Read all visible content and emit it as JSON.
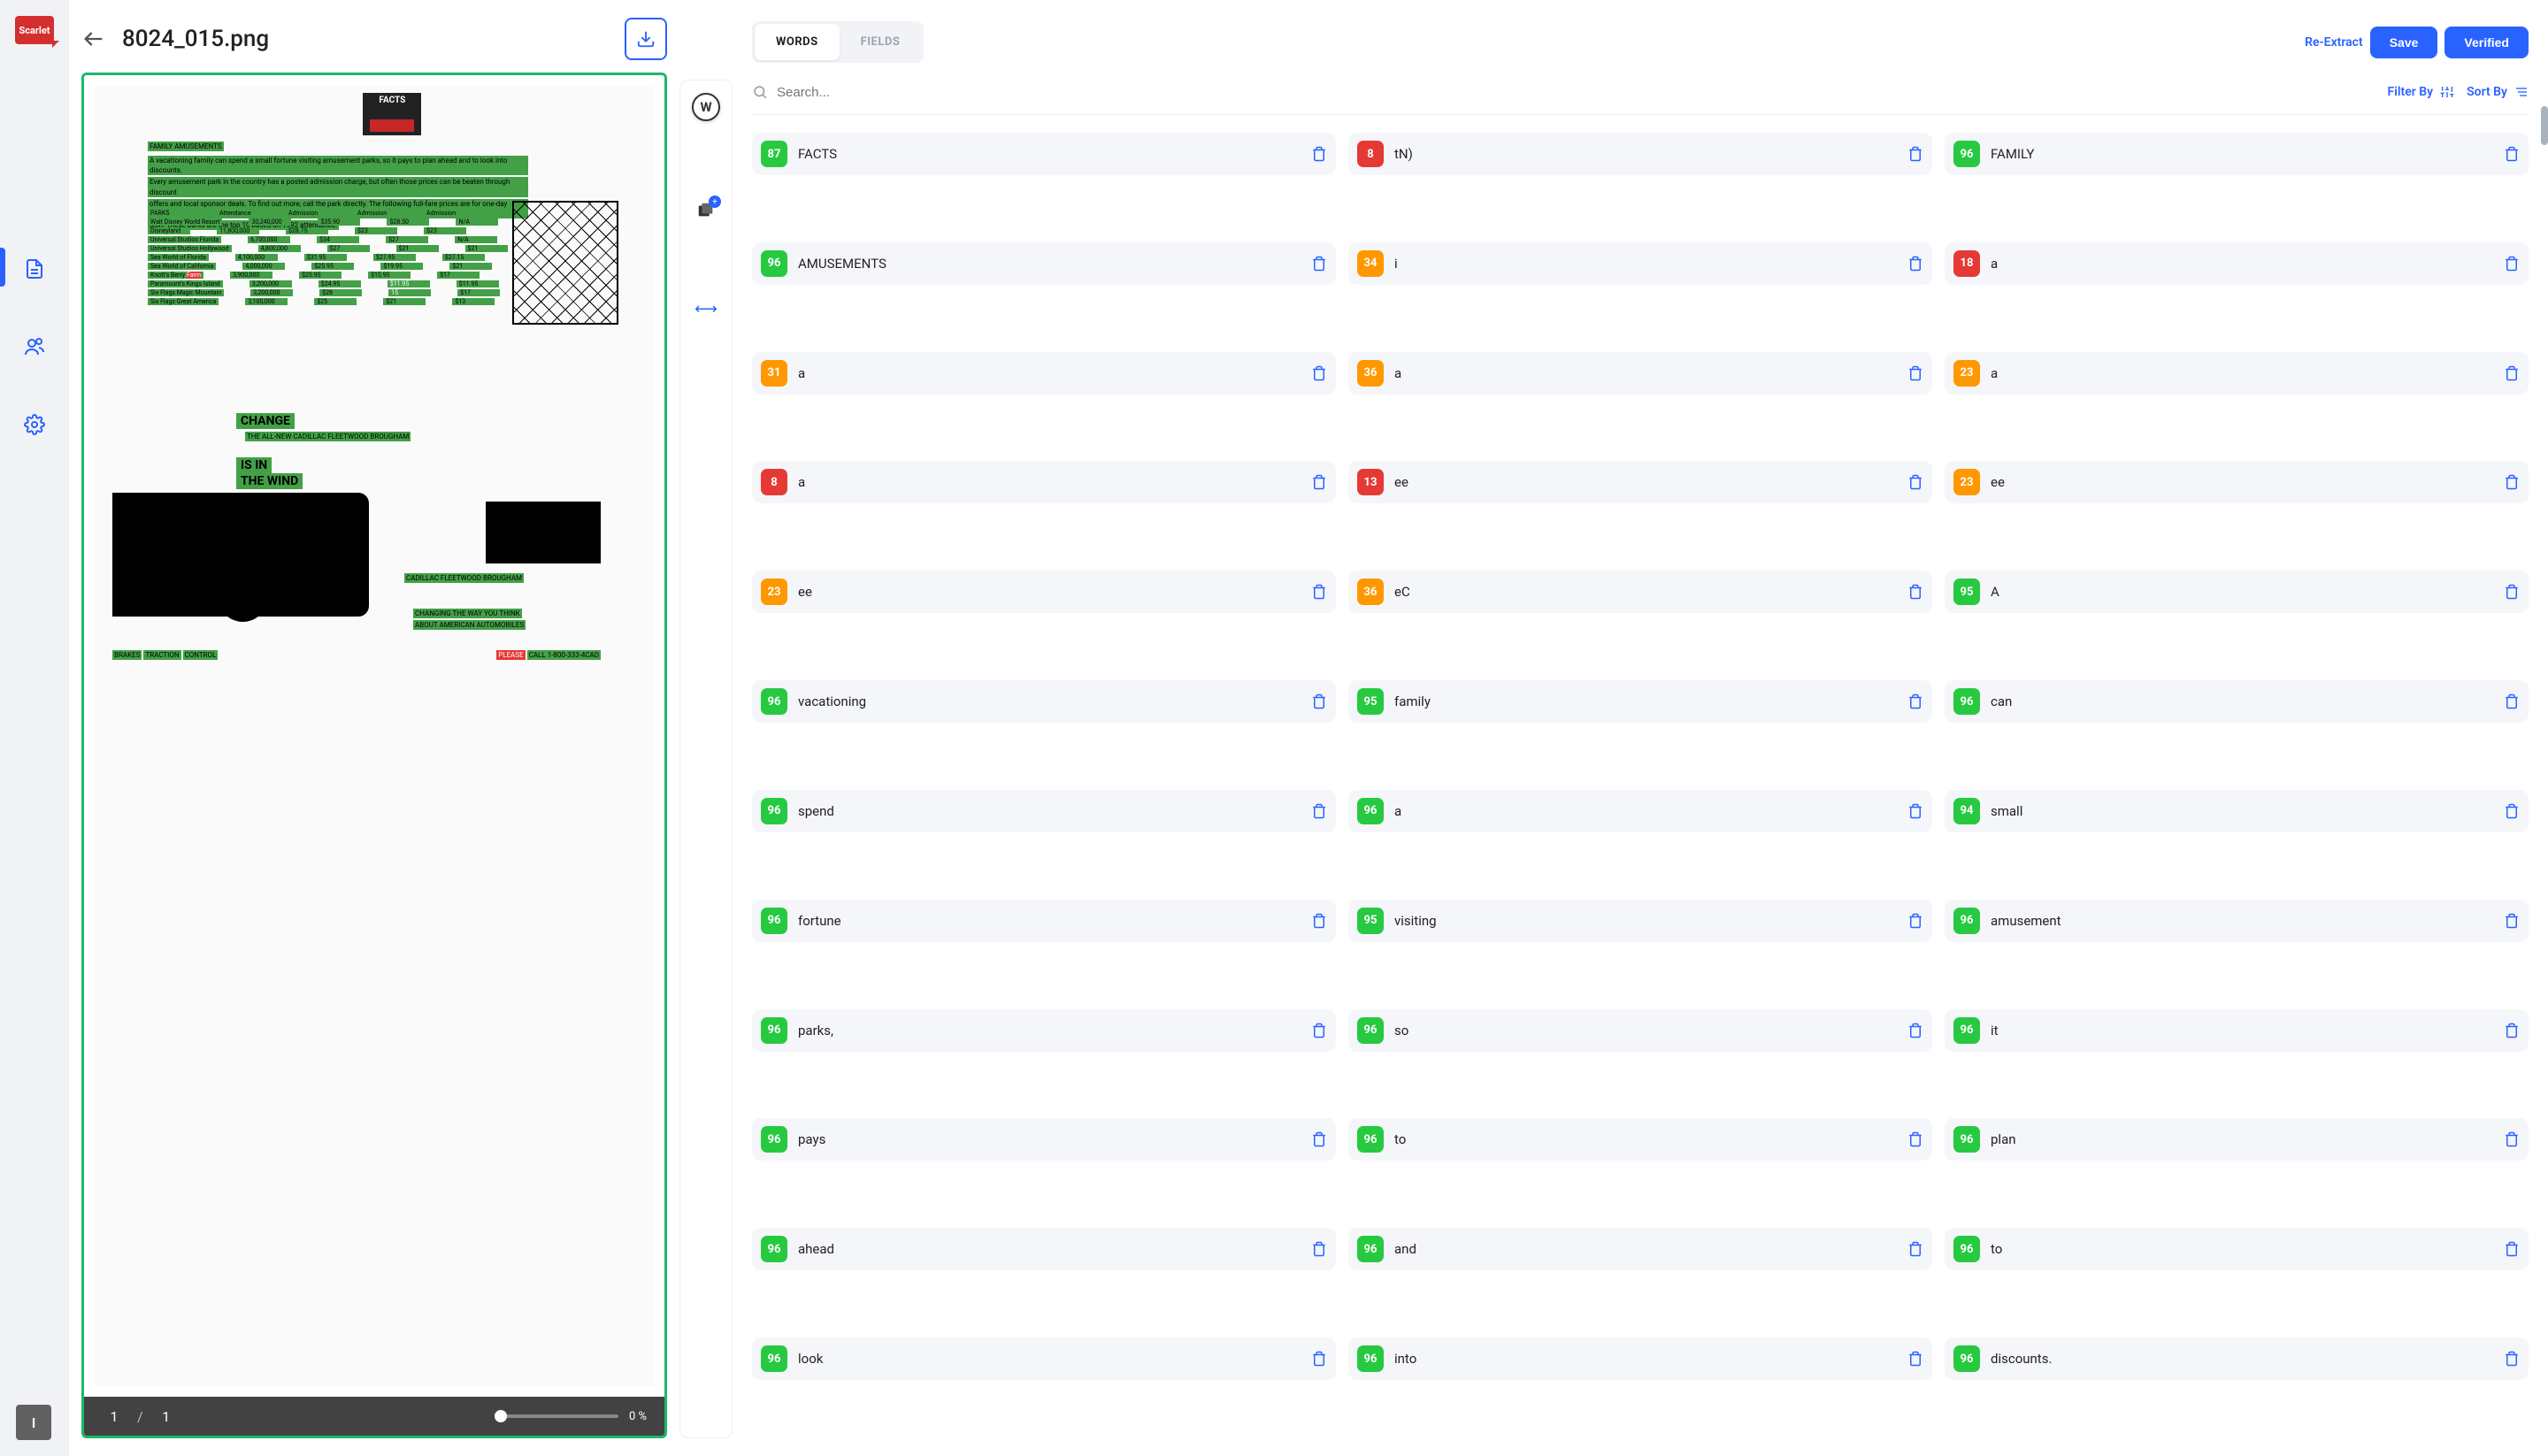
{
  "logo_text": "Scarlet",
  "doc_title": "8024_015.png",
  "side_key_label": "I",
  "tool_rail": {
    "w_label": "W"
  },
  "footer": {
    "page_current": "1",
    "page_total": "1",
    "zoom": "0 %"
  },
  "tabs": {
    "words": "WORDS",
    "fields": "FIELDS"
  },
  "actions": {
    "re_extract": "Re-Extract",
    "save": "Save",
    "verified": "Verified"
  },
  "search_placeholder": "Search...",
  "filter_label": "Filter By",
  "sort_label": "Sort By",
  "doc_preview": {
    "facts": "FACTS",
    "heading1": "FAMILY AMUSEMENTS",
    "change": "CHANGE",
    "isin": "IS IN",
    "wind": "THE WIND",
    "brake": "BRAKES",
    "traction": "TRACTION",
    "control": "CONTROL",
    "please": "PLEASE",
    "call": "CALL 1-800-333-4CAD",
    "cadillac": "CADILLAC FLEETWOOD BROUGHAM",
    "ad_line": "THE ALL-NEW CADILLAC FLEETWOOD BROUGHAM",
    "changing1": "CHANGING THE WAY YOU THINK",
    "changing2": "ABOUT AMERICAN AUTOMOBILES"
  },
  "words": [
    {
      "c": 87,
      "t": "FACTS",
      "cls": "high"
    },
    {
      "c": 8,
      "t": "tN)",
      "cls": "low"
    },
    {
      "c": 96,
      "t": "FAMILY",
      "cls": "high"
    },
    {
      "c": 96,
      "t": "AMUSEMENTS",
      "cls": "high"
    },
    {
      "c": 34,
      "t": "i",
      "cls": "med"
    },
    {
      "c": 18,
      "t": "a",
      "cls": "low"
    },
    {
      "c": 31,
      "t": "a",
      "cls": "med"
    },
    {
      "c": 36,
      "t": "a",
      "cls": "med"
    },
    {
      "c": 23,
      "t": "a",
      "cls": "med"
    },
    {
      "c": 8,
      "t": "a",
      "cls": "low"
    },
    {
      "c": 13,
      "t": "ee",
      "cls": "low"
    },
    {
      "c": 23,
      "t": "ee",
      "cls": "med"
    },
    {
      "c": 23,
      "t": "ee",
      "cls": "med"
    },
    {
      "c": 36,
      "t": "eC",
      "cls": "med"
    },
    {
      "c": 95,
      "t": "A",
      "cls": "high"
    },
    {
      "c": 96,
      "t": "vacationing",
      "cls": "high"
    },
    {
      "c": 95,
      "t": "family",
      "cls": "high"
    },
    {
      "c": 96,
      "t": "can",
      "cls": "high"
    },
    {
      "c": 96,
      "t": "spend",
      "cls": "high"
    },
    {
      "c": 96,
      "t": "a",
      "cls": "high"
    },
    {
      "c": 94,
      "t": "small",
      "cls": "high"
    },
    {
      "c": 96,
      "t": "fortune",
      "cls": "high"
    },
    {
      "c": 95,
      "t": "visiting",
      "cls": "high"
    },
    {
      "c": 96,
      "t": "amusement",
      "cls": "high"
    },
    {
      "c": 96,
      "t": "parks,",
      "cls": "high"
    },
    {
      "c": 96,
      "t": "so",
      "cls": "high"
    },
    {
      "c": 96,
      "t": "it",
      "cls": "high"
    },
    {
      "c": 96,
      "t": "pays",
      "cls": "high"
    },
    {
      "c": 96,
      "t": "to",
      "cls": "high"
    },
    {
      "c": 96,
      "t": "plan",
      "cls": "high"
    },
    {
      "c": 96,
      "t": "ahead",
      "cls": "high"
    },
    {
      "c": 96,
      "t": "and",
      "cls": "high"
    },
    {
      "c": 96,
      "t": "to",
      "cls": "high"
    },
    {
      "c": 96,
      "t": "look",
      "cls": "high"
    },
    {
      "c": 96,
      "t": "into",
      "cls": "high"
    },
    {
      "c": 96,
      "t": "discounts.",
      "cls": "high"
    }
  ]
}
